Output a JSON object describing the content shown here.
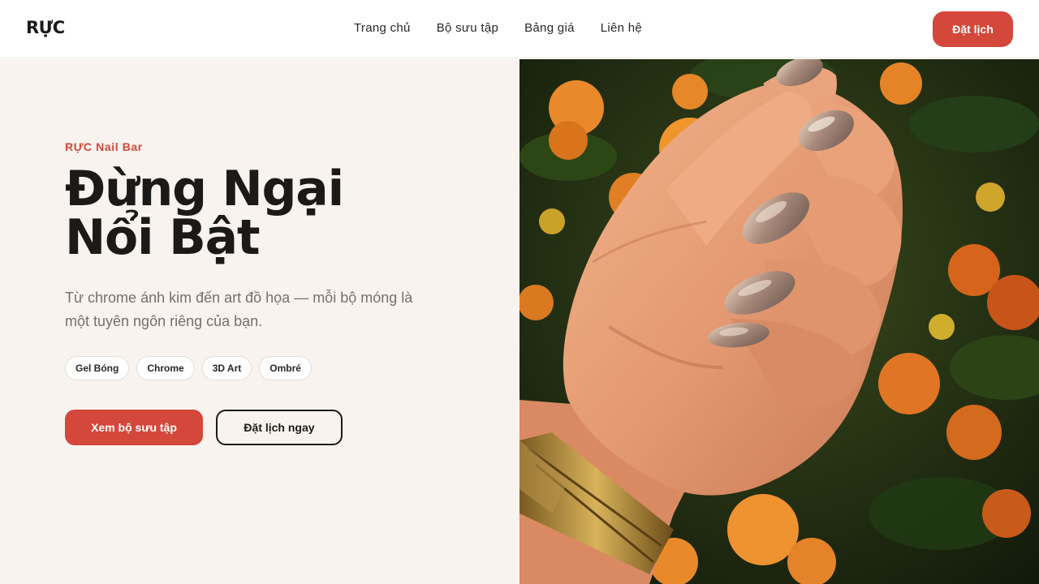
{
  "header": {
    "logo": "RỰC",
    "nav": [
      "Trang chủ",
      "Bộ sưu tập",
      "Bảng giá",
      "Liên hệ"
    ],
    "book_label": "Đặt lịch"
  },
  "hero": {
    "eyebrow": "RỰC Nail Bar",
    "headline_line1": "Đừng Ngại",
    "headline_line2": "Nổi Bật",
    "subtitle": "Từ chrome ánh kim đến art đồ họa — mỗi bộ móng là một tuyên ngôn riêng của bạn.",
    "chips": [
      "Gel Bóng",
      "Chrome",
      "3D Art",
      "Ombré"
    ],
    "primary_cta": "Xem bộ sưu tập",
    "secondary_cta": "Đặt lịch ngay"
  },
  "theme": {
    "accent": "#d3483b",
    "cream": "#f8f3ee",
    "ink": "#1c1a18"
  },
  "photo": {
    "subject": "hand-with-chrome-nails-over-marigolds"
  }
}
